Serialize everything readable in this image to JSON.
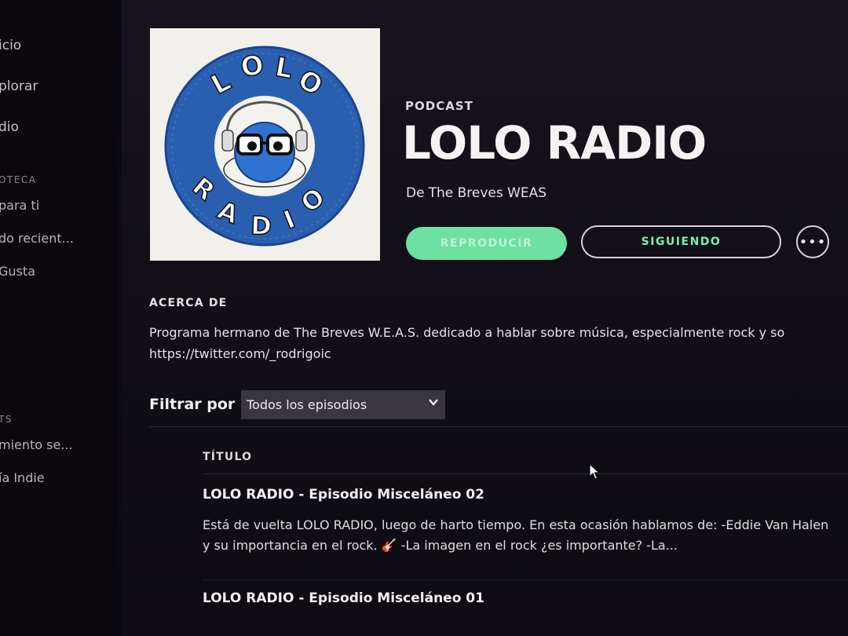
{
  "sidebar": {
    "nav": [
      {
        "label": "icio"
      },
      {
        "label": "plorar"
      },
      {
        "label": "dio"
      }
    ],
    "library_header": "OTECA",
    "library": [
      {
        "label": "para ti"
      },
      {
        "label": "do recient..."
      },
      {
        "label": "Gusta"
      }
    ],
    "playlists_header": "TS",
    "playlists": [
      {
        "label": "miento se..."
      },
      {
        "label": "ía Indie"
      }
    ]
  },
  "podcast": {
    "type_label": "PODCAST",
    "title": "LOLO RADIO",
    "author_prefix": "De",
    "author": "The Breves WEAS",
    "cover": {
      "top_text": "LOLO",
      "bottom_text": "RADIO",
      "ring_color": "#2a5fb0"
    }
  },
  "actions": {
    "play_label": "REPRODUCIR",
    "follow_label": "SIGUIENDO",
    "more_label": "•••",
    "accent": "#1db954"
  },
  "about": {
    "heading": "ACERCA DE",
    "line1": "Programa hermano de The Breves W.E.A.S. dedicado a hablar sobre música, especialmente rock y so",
    "line2": "https://twitter.com/_rodrigoic"
  },
  "filter": {
    "label": "Filtrar por",
    "selected": "Todos los episodios"
  },
  "episodes": {
    "column_title": "TÍTULO",
    "items": [
      {
        "title": "LOLO RADIO - Episodio Misceláneo 02",
        "description": "Está de vuelta LOLO RADIO, luego de harto tiempo. En esta ocasión hablamos de: -Eddie Van Halen y su importancia en el rock. 🎸 -La imagen en el rock ¿es importante? -La..."
      },
      {
        "title": "LOLO RADIO - Episodio Misceláneo 01"
      }
    ]
  }
}
